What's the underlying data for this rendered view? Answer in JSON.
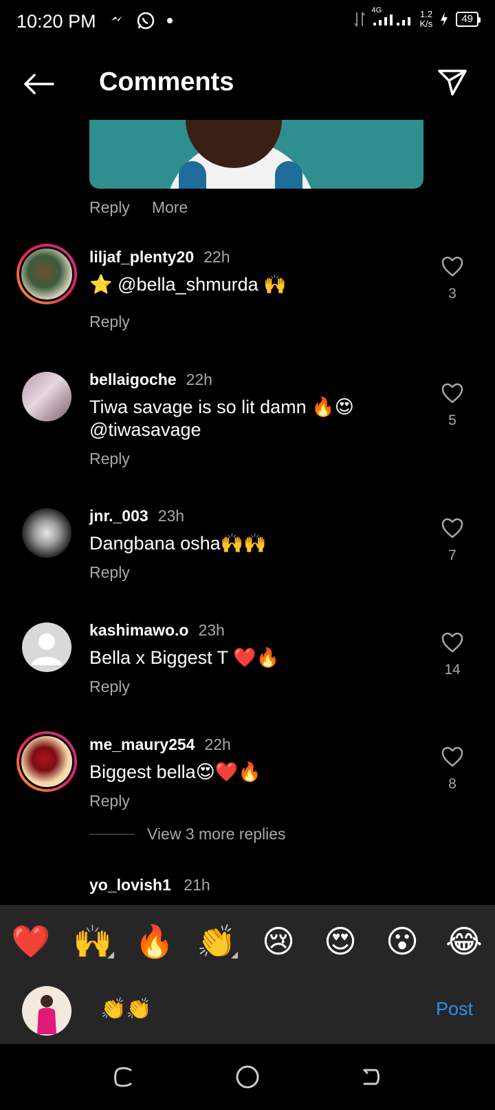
{
  "status": {
    "time": "10:20 PM",
    "network": "4G",
    "speed_value": "1.2",
    "speed_unit": "K/s",
    "battery": "49"
  },
  "header": {
    "title": "Comments"
  },
  "top_comment_actions": {
    "reply": "Reply",
    "more": "More"
  },
  "comments": [
    {
      "username": "liljaf_plenty20",
      "time": "22h",
      "text": "⭐ @bella_shmurda 🙌",
      "reply": "Reply",
      "likes": "3"
    },
    {
      "username": "bellaigoche",
      "time": "22h",
      "text": "Tiwa savage is so lit damn 🔥😍 @tiwasavage",
      "reply": "Reply",
      "likes": "5"
    },
    {
      "username": "jnr._003",
      "time": "23h",
      "text": "Dangbana osha🙌🙌",
      "reply": "Reply",
      "likes": "7"
    },
    {
      "username": "kashimawo.o",
      "time": "23h",
      "text": "Bella x Biggest T ❤️🔥",
      "reply": "Reply",
      "likes": "14"
    },
    {
      "username": "me_maury254",
      "time": "22h",
      "text": "Biggest bella😍❤️🔥",
      "reply": "Reply",
      "likes": "8"
    }
  ],
  "view_more_replies": "View 3 more replies",
  "peek_comment": {
    "username": "yo_lovish1",
    "time": "21h"
  },
  "emoji_bar": [
    "❤️",
    "🙌",
    "🔥",
    "👏",
    "😢",
    "😍",
    "😮",
    "😂"
  ],
  "composer": {
    "value": "👏👏",
    "post_label": "Post"
  },
  "colors": {
    "accent": "#2d8ff0",
    "secondary_text": "#a8a8a8",
    "surface": "#262626"
  }
}
